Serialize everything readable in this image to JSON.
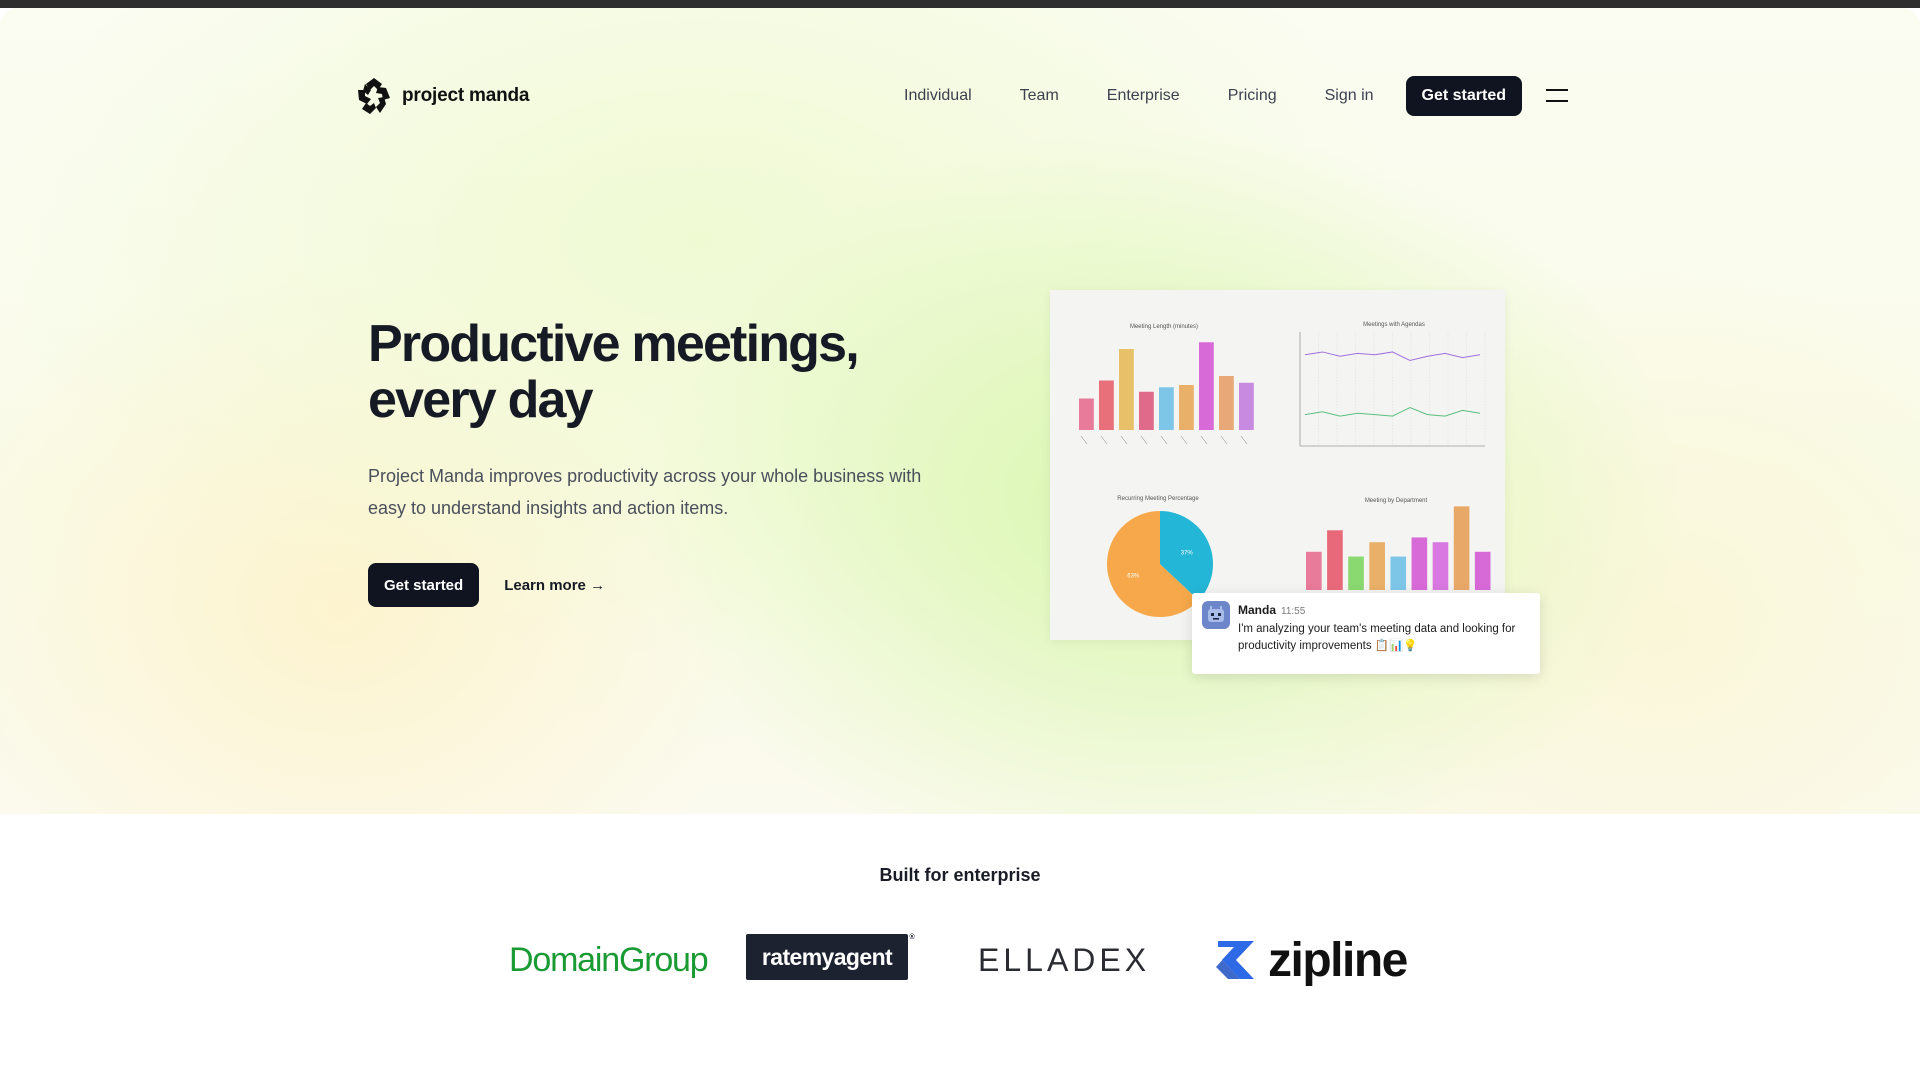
{
  "brand": {
    "name": "project manda"
  },
  "nav": {
    "links": [
      "Individual",
      "Team",
      "Enterprise",
      "Pricing"
    ],
    "sign_in": "Sign in",
    "cta": "Get started"
  },
  "hero": {
    "headline_line1": "Productive meetings,",
    "headline_line2": "every day",
    "subtext": "Project Manda improves productivity across your whole business with easy to understand insights and action items.",
    "primary_cta": "Get started",
    "secondary_cta": "Learn more →"
  },
  "dashboard": {
    "charts": [
      {
        "type": "bar",
        "title": "Meeting Length (minutes)",
        "values": [
          14,
          22,
          36,
          17,
          19,
          20,
          39,
          24,
          21
        ],
        "colors": [
          "#e87a9a",
          "#e8707a",
          "#e8c06a",
          "#e06a8a",
          "#7ec6e8",
          "#e8b068",
          "#d86ad8",
          "#e8a878",
          "#c88ae0"
        ]
      },
      {
        "type": "line",
        "title": "Meetings with Agendas",
        "series": [
          {
            "color": "#a070e0",
            "values": [
              64,
              66,
              63,
              65,
              64,
              66,
              60,
              63,
              65,
              62,
              64
            ]
          },
          {
            "color": "#5ac080",
            "values": [
              22,
              24,
              21,
              23,
              22,
              21,
              27,
              22,
              21,
              25,
              23
            ]
          }
        ]
      },
      {
        "type": "pie",
        "title": "Recurring Meeting Percentage",
        "values": [
          63,
          37
        ],
        "labels": [
          "63%",
          "37%"
        ],
        "colors": [
          "#f7a84a",
          "#24b6d6"
        ]
      },
      {
        "type": "bar",
        "title": "Meeting by Department",
        "values": [
          16,
          25,
          14,
          20,
          14,
          22,
          20,
          35,
          16
        ],
        "colors": [
          "#e87a9a",
          "#e86a7a",
          "#8ad870",
          "#e8b068",
          "#7ec6e8",
          "#d86ad8",
          "#d878e0",
          "#e8a868",
          "#d86ad8"
        ]
      }
    ],
    "chat": {
      "name": "Manda",
      "time": "11:55",
      "message": "I'm analyzing your team's meeting data and looking for productivity improvements 📋📊💡"
    }
  },
  "enterprise": {
    "heading": "Built for enterprise",
    "logos": [
      "DomainGroup",
      "ratemyagent",
      "ELLADEX",
      "zipline"
    ]
  },
  "colors": {
    "accent_dark": "#0f1420",
    "domain_green": "#1a9a33",
    "zipline_blue": "#2f6ae6"
  }
}
